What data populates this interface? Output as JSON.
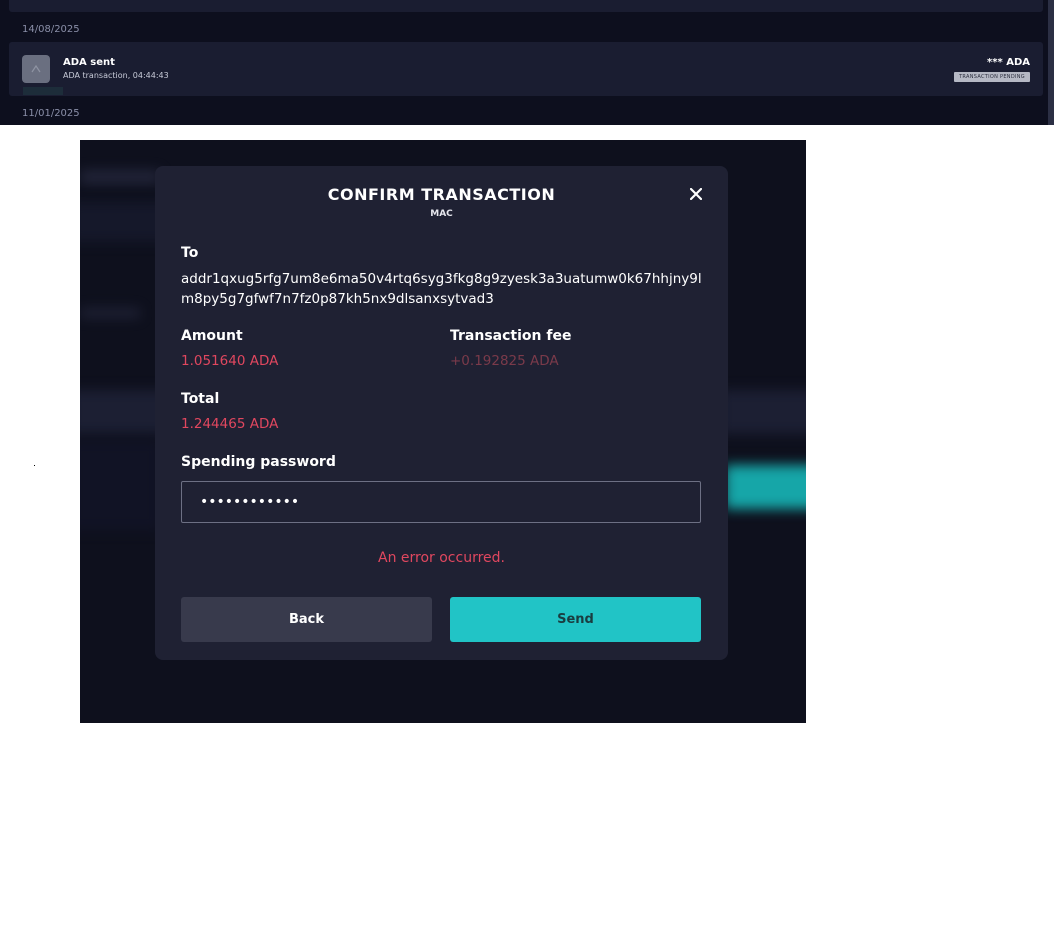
{
  "transactions": {
    "dates": [
      "14/08/2025",
      "11/01/2025"
    ],
    "row": {
      "title": "ADA sent",
      "subtitle": "ADA transaction, 04:44:43",
      "amount": "*** ADA",
      "status": "TRANSACTION PENDING",
      "icon": "transaction-sent-icon"
    }
  },
  "dialog": {
    "title": "CONFIRM TRANSACTION",
    "subtitle": "MAC",
    "close_icon": "close-icon",
    "to_label": "To",
    "address": "addr1qxug5rfg7um8e6ma50v4rtq6syg3fkg8g9zyesk3a3uatumw0k67hhjny9lm8py5g7gfwf7n7fz0p87kh5nx9dlsanxsytvad3",
    "amount_label": "Amount",
    "amount_value": "1.051640 ADA",
    "fee_label": "Transaction fee",
    "fee_value": "+0.192825 ADA",
    "total_label": "Total",
    "total_value": "1.244465 ADA",
    "password_label": "Spending password",
    "password_value": "••••••••••••",
    "error": "An error occurred.",
    "back_label": "Back",
    "send_label": "Send"
  },
  "colors": {
    "background": "#0d0f1e",
    "modal": "#1f2133",
    "accent": "#21c4c6",
    "error": "#e0475f"
  }
}
